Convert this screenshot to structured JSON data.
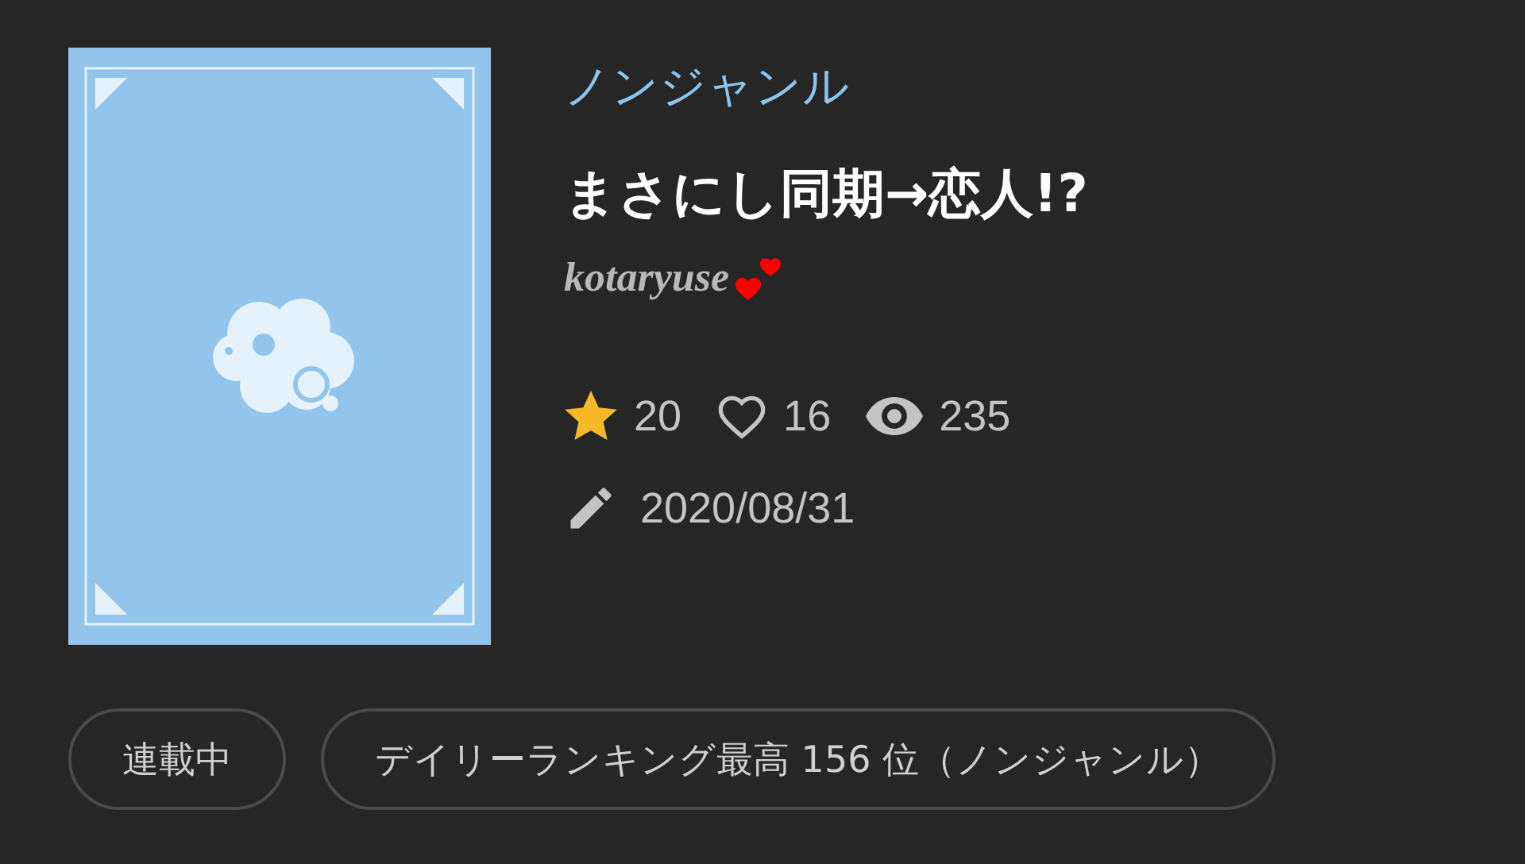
{
  "genre": "ノンジャンル",
  "title": "まさにし同期→恋人!?",
  "author": "kotaryuse",
  "stats": [
    {
      "kind": "star",
      "value": "20"
    },
    {
      "kind": "heart",
      "value": "16"
    },
    {
      "kind": "view",
      "value": "235"
    }
  ],
  "updated": "2020/08/31",
  "tags": [
    "連載中",
    "デイリーランキング最高 156 位（ノンジャンル）"
  ]
}
